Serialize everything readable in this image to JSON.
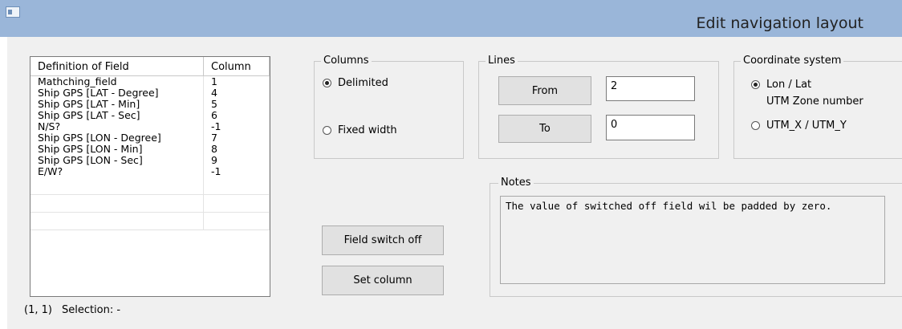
{
  "window": {
    "title": "Edit navigation layout"
  },
  "grid": {
    "headers": [
      "Definition of Field",
      "Column"
    ],
    "rows": [
      [
        "Mathching_field",
        "1"
      ],
      [
        "Ship GPS [LAT - Degree]",
        "4"
      ],
      [
        "Ship GPS [LAT - Min]",
        "5"
      ],
      [
        "Ship GPS [LAT - Sec]",
        "6"
      ],
      [
        "N/S?",
        "-1"
      ],
      [
        "Ship GPS [LON - Degree]",
        "7"
      ],
      [
        "Ship GPS [LON - Min]",
        "8"
      ],
      [
        "Ship GPS [LON - Sec]",
        "9"
      ],
      [
        "E/W?",
        "-1"
      ]
    ]
  },
  "status": {
    "position": "(1, 1)",
    "selection": "Selection: -"
  },
  "columns": {
    "label": "Columns",
    "delimited": "Delimited",
    "fixed_width": "Fixed width",
    "selected": "delimited"
  },
  "lines": {
    "label": "Lines",
    "from_button": "From",
    "from_value": "2",
    "to_button": "To",
    "to_value": "0"
  },
  "coordinate_system": {
    "label": "Coordinate system",
    "lon_lat": "Lon / Lat",
    "utm_zone": "UTM Zone number",
    "utm_xy": "UTM_X / UTM_Y",
    "selected": "lon_lat"
  },
  "notes": {
    "label": "Notes",
    "text": "The value of switched off field wil be padded by zero."
  },
  "actions": {
    "field_switch_off": "Field switch off",
    "set_column": "Set column"
  }
}
